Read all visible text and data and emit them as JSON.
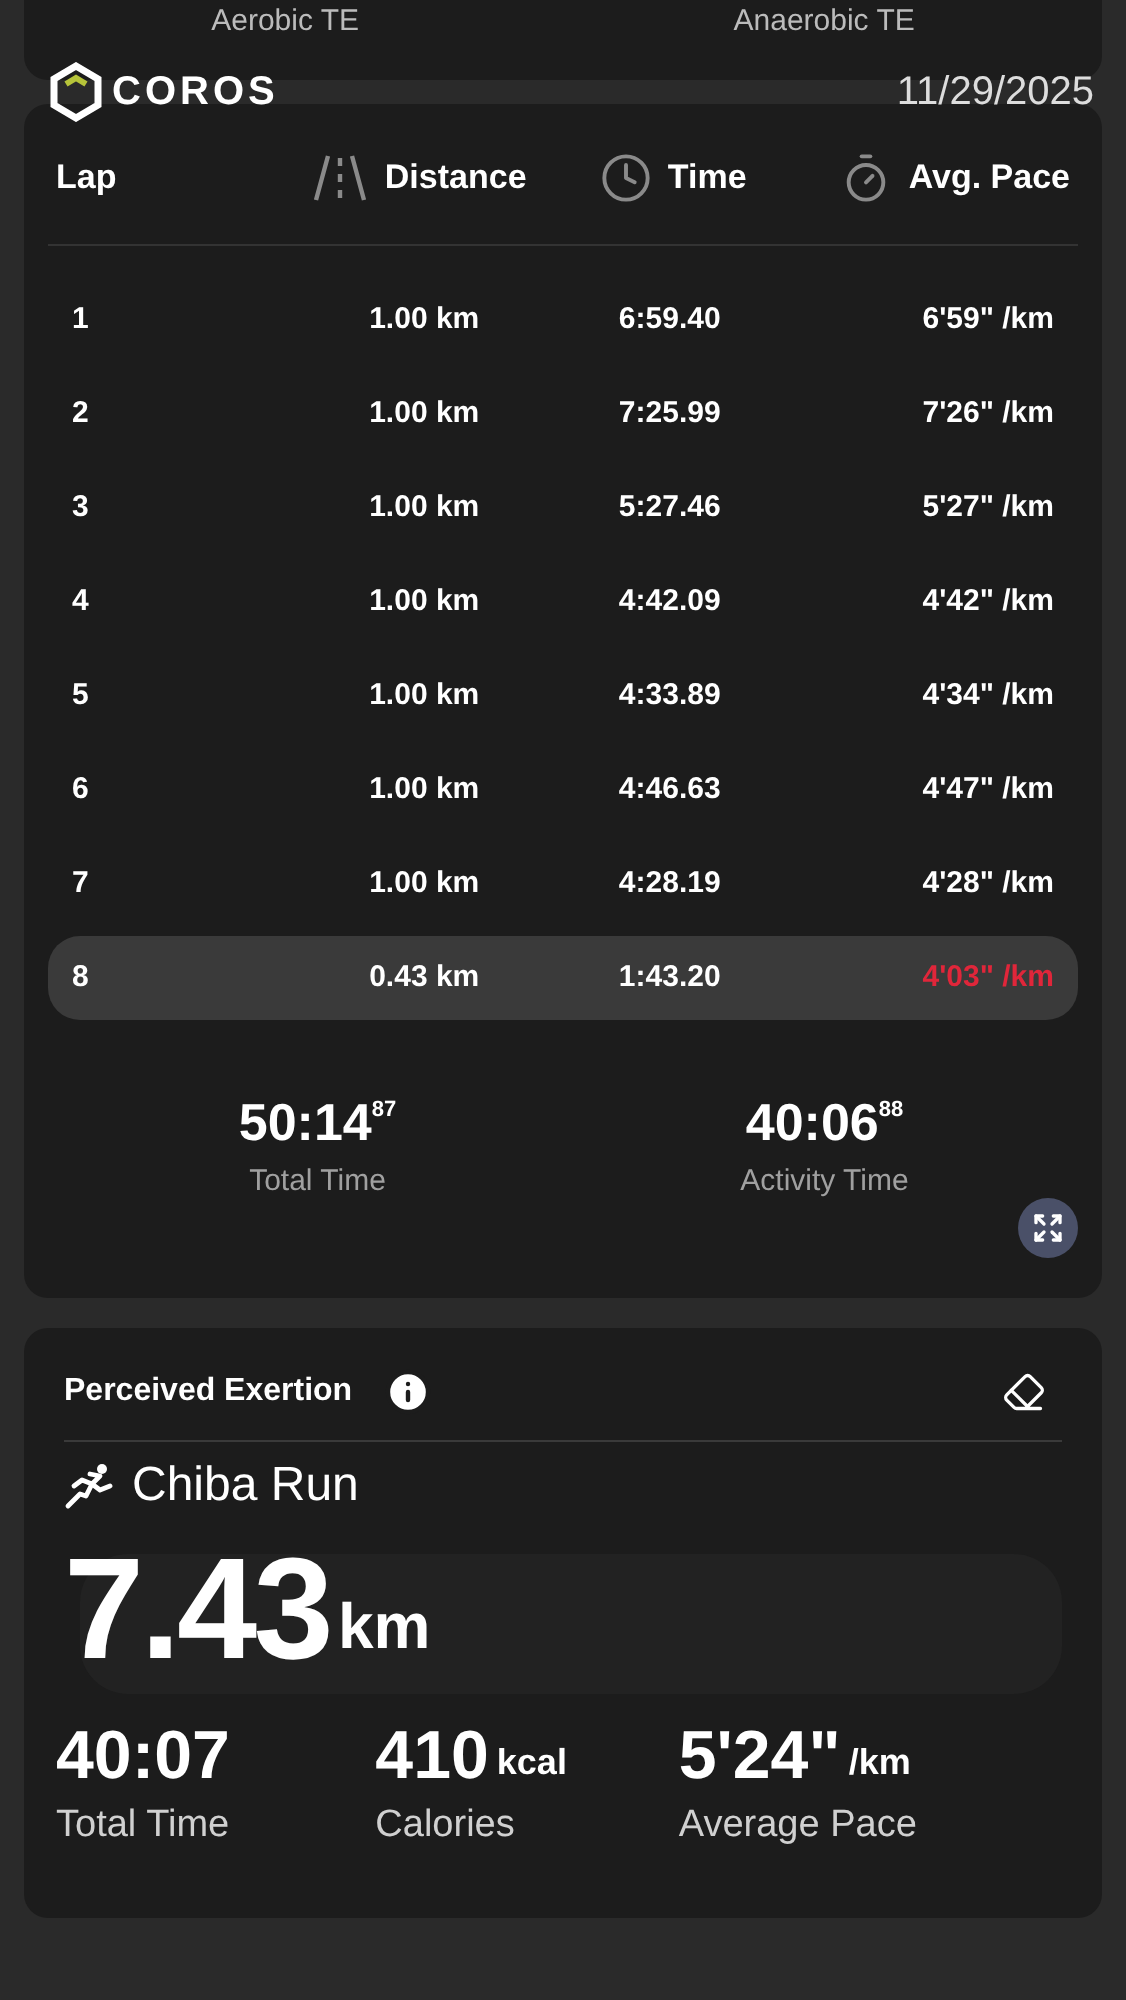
{
  "top_card": {
    "labels": [
      "Aerobic TE",
      "Anaerobic TE"
    ]
  },
  "brand": {
    "name": "COROS",
    "date": "11/29/2025"
  },
  "laps": {
    "columns": [
      "Lap",
      "Distance",
      "Time",
      "Avg. Pace"
    ],
    "rows": [
      {
        "lap": "1",
        "distance": "1.00 km",
        "time": "6:59.40",
        "pace": "6'59\" /km",
        "selected": false
      },
      {
        "lap": "2",
        "distance": "1.00 km",
        "time": "7:25.99",
        "pace": "7'26\" /km",
        "selected": false
      },
      {
        "lap": "3",
        "distance": "1.00 km",
        "time": "5:27.46",
        "pace": "5'27\" /km",
        "selected": false
      },
      {
        "lap": "4",
        "distance": "1.00 km",
        "time": "4:42.09",
        "pace": "4'42\" /km",
        "selected": false
      },
      {
        "lap": "5",
        "distance": "1.00 km",
        "time": "4:33.89",
        "pace": "4'34\" /km",
        "selected": false
      },
      {
        "lap": "6",
        "distance": "1.00 km",
        "time": "4:46.63",
        "pace": "4'47\" /km",
        "selected": false
      },
      {
        "lap": "7",
        "distance": "1.00 km",
        "time": "4:28.19",
        "pace": "4'28\" /km",
        "selected": false
      },
      {
        "lap": "8",
        "distance": "0.43 km",
        "time": "1:43.20",
        "pace": "4'03\" /km",
        "selected": true
      }
    ],
    "summary": [
      {
        "value": "50:14",
        "fraction": "87",
        "label": "Total Time"
      },
      {
        "value": "40:06",
        "fraction": "88",
        "label": "Activity Time"
      }
    ]
  },
  "exertion": {
    "title": "Perceived Exertion",
    "activity": "Chiba Run",
    "distance": "7.43",
    "distance_unit": "km",
    "stats": [
      {
        "value": "40:07",
        "label": "Total Time"
      },
      {
        "value": "410",
        "unit": "kcal",
        "label": "Calories"
      },
      {
        "value": "5'24\"",
        "unit": "/km",
        "label": "Average Pace"
      }
    ]
  }
}
